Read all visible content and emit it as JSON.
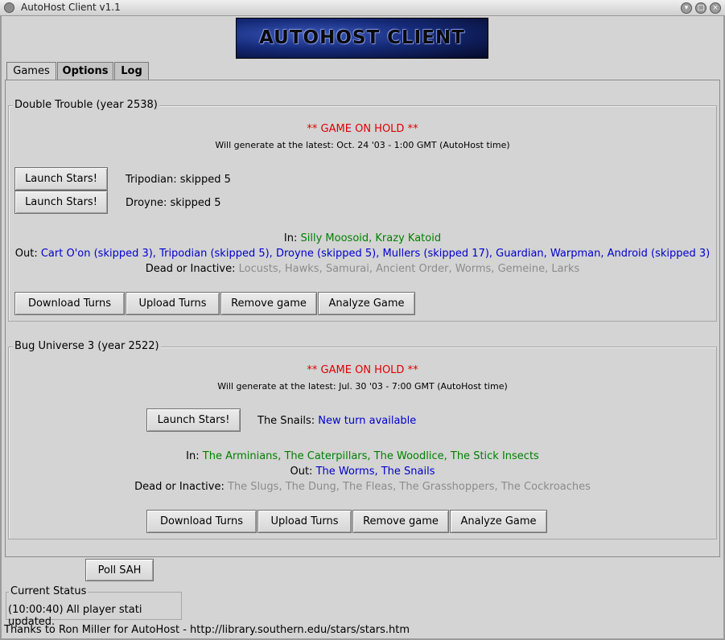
{
  "window": {
    "title": "AutoHost Client v1.1",
    "logo_text": "AUTOHOST CLIENT"
  },
  "tabs": [
    {
      "label": "Games"
    },
    {
      "label": "Options"
    },
    {
      "label": "Log"
    }
  ],
  "games": [
    {
      "title": "Double Trouble  (year 2538)",
      "status": "** GAME ON HOLD **",
      "generate": "Will generate at the latest: Oct. 24 '03 - 1:00 GMT (AutoHost time)",
      "launches": [
        {
          "button": "Launch Stars!",
          "player": "Tripodian: skipped 5"
        },
        {
          "button": "Launch Stars!",
          "player": "Droyne: skipped 5"
        }
      ],
      "in_label": "In:",
      "in_players": "Silly Moosoid, Krazy Katoid",
      "out_label": "Out:",
      "out_players": "Cart O'on (skipped 3), Tripodian (skipped 5), Droyne (skipped 5), Mullers (skipped 17), Guardian, Warpman, Android (skipped 3)",
      "dead_label": "Dead or Inactive:",
      "dead_players": "Locusts, Hawks, Samurai, Ancient Order, Worms, Gemeine, Larks",
      "actions": [
        "Download Turns",
        "Upload Turns",
        "Remove game",
        "Analyze Game"
      ]
    },
    {
      "title": "Bug Universe 3 (year 2522)",
      "status": "** GAME ON HOLD **",
      "generate": "Will generate at the latest: Jul. 30 '03 - 7:00 GMT (AutoHost time)",
      "launches": [
        {
          "button": "Launch Stars!",
          "player": "The Snails:",
          "turn_status": "New turn available"
        }
      ],
      "in_label": "In:",
      "in_players": "The Arminians, The Caterpillars, The Woodlice, The Stick Insects",
      "out_label": "Out:",
      "out_players": "The Worms, The Snails",
      "dead_label": "Dead or Inactive:",
      "dead_players": "The Slugs, The Dung, The Fleas, The Grasshoppers, The Cockroaches",
      "actions": [
        "Download Turns",
        "Upload Turns",
        "Remove game",
        "Analyze Game"
      ]
    }
  ],
  "poll_button": "Poll SAH",
  "current_status": {
    "label": "Current Status",
    "text": "(10:00:40) All player stati updated."
  },
  "footer": "Thanks to Ron Miller for AutoHost - http://library.southern.edu/stars/stars.htm",
  "colors": {
    "hold": "#e00000",
    "in": "#008000",
    "out": "#0000cc",
    "dead": "#8c8c8c"
  }
}
